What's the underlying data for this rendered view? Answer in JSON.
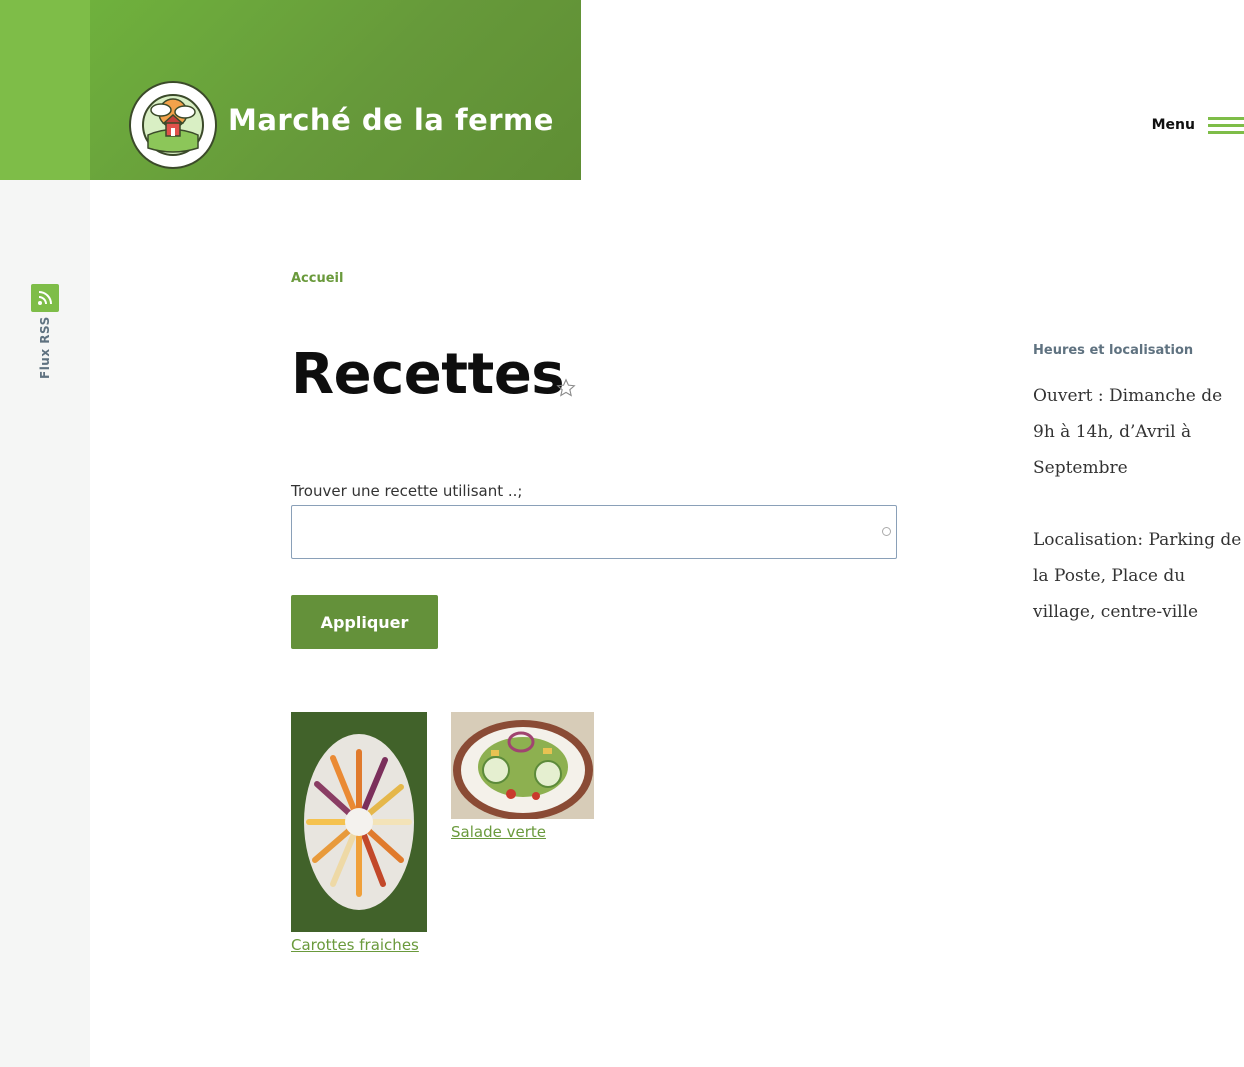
{
  "site": {
    "title": "Marché de la ferme",
    "logo_name": "farm-market-logo"
  },
  "header": {
    "menu_label": "Menu"
  },
  "rss": {
    "label": "Flux RSS"
  },
  "breadcrumb": {
    "home": "Accueil"
  },
  "page": {
    "title": "Recettes"
  },
  "search": {
    "label": "Trouver une recette utilisant ..;",
    "value": "",
    "placeholder": ""
  },
  "form": {
    "apply_label": "Appliquer"
  },
  "recipes": [
    {
      "title": "Carottes fraiches",
      "image": "carrots-photo"
    },
    {
      "title": "Salade verte",
      "image": "salad-photo"
    }
  ],
  "sidebar": {
    "title": "Heures et localisation",
    "hours": "Ouvert : Dimanche de 9h à 14h, d’Avril à Septembre",
    "location": "Localisation: Parking de la Poste, Place du village, centre-ville"
  },
  "colors": {
    "accent": "#7ebd48",
    "brand_dark": "#64913a",
    "link": "#6a9a3c"
  },
  "icons": [
    "rss-icon",
    "star-icon",
    "hamburger-icon"
  ]
}
